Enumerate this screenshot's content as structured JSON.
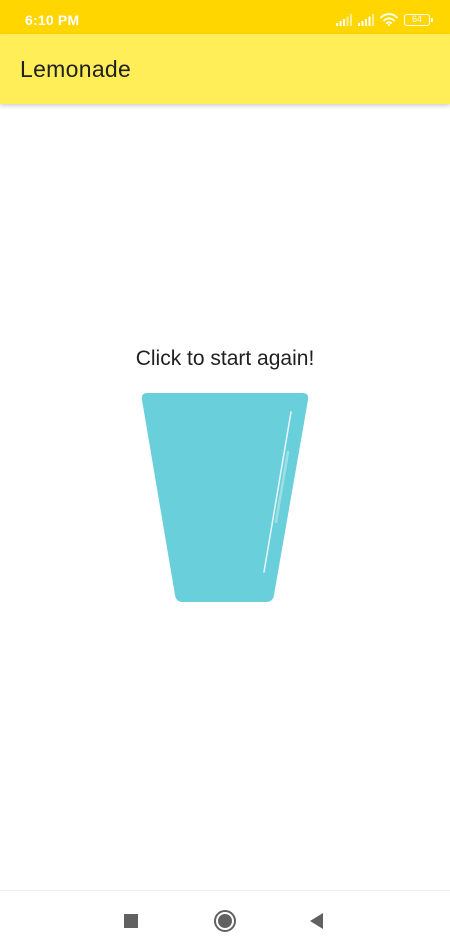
{
  "status_bar": {
    "time": "6:10 PM",
    "battery_level": "64",
    "icons": [
      "signal-icon",
      "signal-icon",
      "wifi-icon",
      "battery-icon"
    ]
  },
  "app_bar": {
    "title": "Lemonade"
  },
  "main": {
    "prompt": "Click to start again!",
    "image": "empty-glass-icon"
  },
  "nav_bar": {
    "icons": [
      "recents-square-icon",
      "home-circle-icon",
      "back-triangle-icon"
    ]
  },
  "colors": {
    "status_bar": "#FFD600",
    "app_bar": "#FFEE58",
    "glass": "#69CFDA",
    "text": "#212121"
  }
}
